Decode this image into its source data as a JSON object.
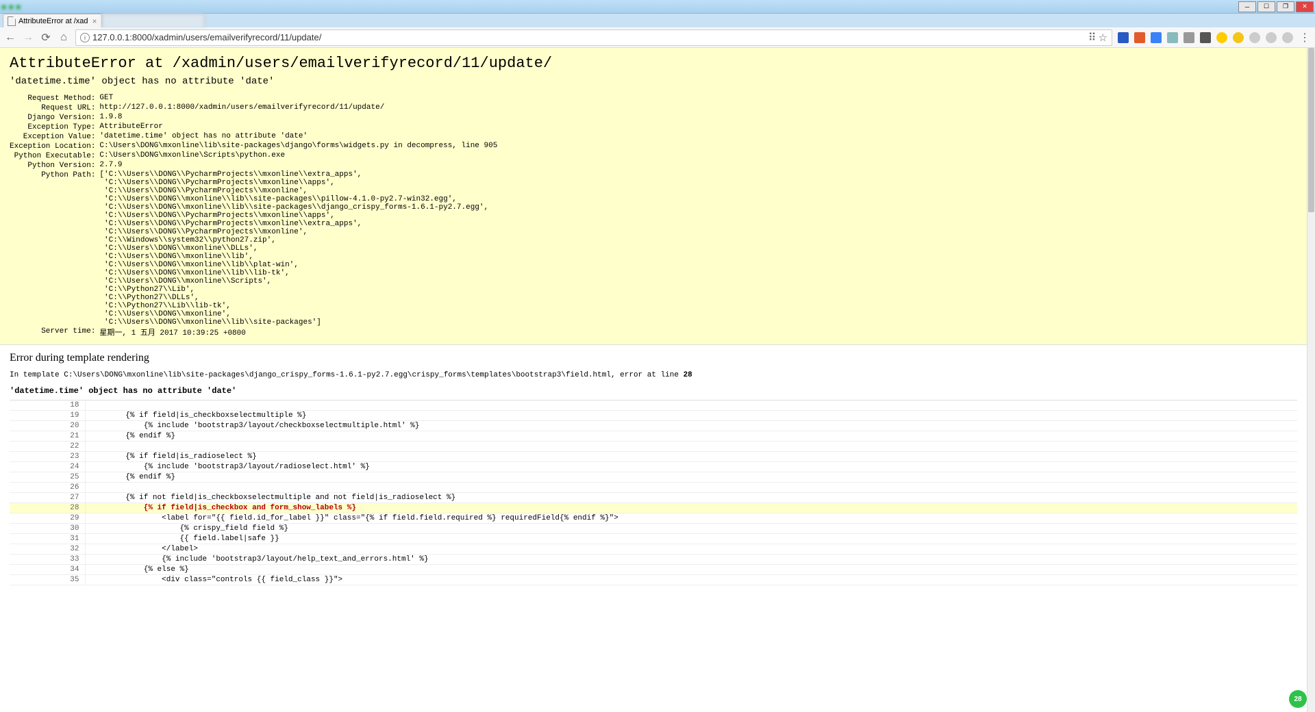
{
  "chrome": {
    "tab_title": "AttributeError at /xad",
    "url": "127.0.0.1:8000/xadmin/users/emailverifyrecord/11/update/"
  },
  "error": {
    "title": "AttributeError at /xadmin/users/emailverifyrecord/11/update/",
    "exception_value_top": "'datetime.time' object has no attribute 'date'",
    "meta": {
      "request_method_label": "Request Method:",
      "request_method": "GET",
      "request_url_label": "Request URL:",
      "request_url": "http://127.0.0.1:8000/xadmin/users/emailverifyrecord/11/update/",
      "django_version_label": "Django Version:",
      "django_version": "1.9.8",
      "exception_type_label": "Exception Type:",
      "exception_type": "AttributeError",
      "exception_value_label": "Exception Value:",
      "exception_value": "'datetime.time' object has no attribute 'date'",
      "exception_location_label": "Exception Location:",
      "exception_location": "C:\\Users\\DONG\\mxonline\\lib\\site-packages\\django\\forms\\widgets.py in decompress, line 905",
      "python_executable_label": "Python Executable:",
      "python_executable": "C:\\Users\\DONG\\mxonline\\Scripts\\python.exe",
      "python_version_label": "Python Version:",
      "python_version": "2.7.9",
      "python_path_label": "Python Path:",
      "python_path": "['C:\\\\Users\\\\DONG\\\\PycharmProjects\\\\mxonline\\\\extra_apps',\n 'C:\\\\Users\\\\DONG\\\\PycharmProjects\\\\mxonline\\\\apps',\n 'C:\\\\Users\\\\DONG\\\\PycharmProjects\\\\mxonline',\n 'C:\\\\Users\\\\DONG\\\\mxonline\\\\lib\\\\site-packages\\\\pillow-4.1.0-py2.7-win32.egg',\n 'C:\\\\Users\\\\DONG\\\\mxonline\\\\lib\\\\site-packages\\\\django_crispy_forms-1.6.1-py2.7.egg',\n 'C:\\\\Users\\\\DONG\\\\PycharmProjects\\\\mxonline\\\\apps',\n 'C:\\\\Users\\\\DONG\\\\PycharmProjects\\\\mxonline\\\\extra_apps',\n 'C:\\\\Users\\\\DONG\\\\PycharmProjects\\\\mxonline',\n 'C:\\\\Windows\\\\system32\\\\python27.zip',\n 'C:\\\\Users\\\\DONG\\\\mxonline\\\\DLLs',\n 'C:\\\\Users\\\\DONG\\\\mxonline\\\\lib',\n 'C:\\\\Users\\\\DONG\\\\mxonline\\\\lib\\\\plat-win',\n 'C:\\\\Users\\\\DONG\\\\mxonline\\\\lib\\\\lib-tk',\n 'C:\\\\Users\\\\DONG\\\\mxonline\\\\Scripts',\n 'C:\\\\Python27\\\\Lib',\n 'C:\\\\Python27\\\\DLLs',\n 'C:\\\\Python27\\\\Lib\\\\lib-tk',\n 'C:\\\\Users\\\\DONG\\\\mxonline',\n 'C:\\\\Users\\\\DONG\\\\mxonline\\\\lib\\\\site-packages']",
      "server_time_label": "Server time:",
      "server_time": "星期一, 1 五月 2017 10:39:25 +0800"
    }
  },
  "template": {
    "heading": "Error during template rendering",
    "location_prefix": "In template ",
    "location_path": "C:\\Users\\DONG\\mxonline\\lib\\site-packages\\django_crispy_forms-1.6.1-py2.7.egg\\crispy_forms\\templates\\bootstrap3\\field.html",
    "location_suffix": ", error at line ",
    "location_line": "28",
    "error_msg": "'datetime.time' object has no attribute 'date'",
    "lines": [
      {
        "n": "18",
        "code": "",
        "hl": false
      },
      {
        "n": "19",
        "code": "        {% if field|is_checkboxselectmultiple %}",
        "hl": false
      },
      {
        "n": "20",
        "code": "            {% include 'bootstrap3/layout/checkboxselectmultiple.html' %}",
        "hl": false
      },
      {
        "n": "21",
        "code": "        {% endif %}",
        "hl": false
      },
      {
        "n": "22",
        "code": "",
        "hl": false
      },
      {
        "n": "23",
        "code": "        {% if field|is_radioselect %}",
        "hl": false
      },
      {
        "n": "24",
        "code": "            {% include 'bootstrap3/layout/radioselect.html' %}",
        "hl": false
      },
      {
        "n": "25",
        "code": "        {% endif %}",
        "hl": false
      },
      {
        "n": "26",
        "code": "",
        "hl": false
      },
      {
        "n": "27",
        "code": "        {% if not field|is_checkboxselectmultiple and not field|is_radioselect %}",
        "hl": false
      },
      {
        "n": "28",
        "code": "            {% if field|is_checkbox and form_show_labels %}",
        "hl": true
      },
      {
        "n": "29",
        "code": "                <label for=\"{{ field.id_for_label }}\" class=\"{% if field.field.required %} requiredField{% endif %}\">",
        "hl": false
      },
      {
        "n": "30",
        "code": "                    {% crispy_field field %}",
        "hl": false
      },
      {
        "n": "31",
        "code": "                    {{ field.label|safe }}",
        "hl": false
      },
      {
        "n": "32",
        "code": "                </label>",
        "hl": false
      },
      {
        "n": "33",
        "code": "                {% include 'bootstrap3/layout/help_text_and_errors.html' %}",
        "hl": false
      },
      {
        "n": "34",
        "code": "            {% else %}",
        "hl": false
      },
      {
        "n": "35",
        "code": "                <div class=\"controls {{ field_class }}\">",
        "hl": false
      }
    ]
  },
  "badge": "28"
}
